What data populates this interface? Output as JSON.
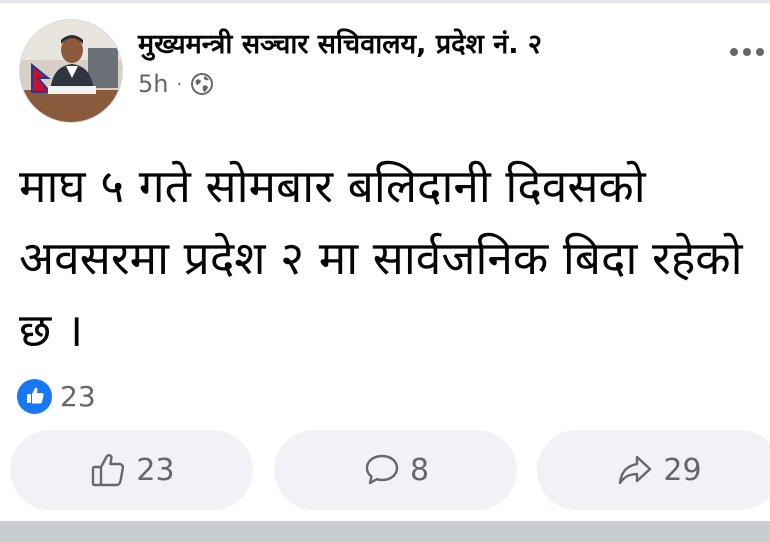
{
  "post": {
    "page_name": "मुख्यमन्त्री सञ्चार सचिवालय, प्रदेश नं. २",
    "time": "5h",
    "separator": "·",
    "privacy_icon": "globe-icon",
    "more_icon": "more-options-icon",
    "text": "माघ ५ गते सोमबार बलिदानी दिवसको अवसरमा प्रदेश २ मा सार्वजनिक बिदा रहेको छ ।"
  },
  "reactions": {
    "icon": "like-reaction-icon",
    "count": "23"
  },
  "actions": {
    "like_count": "23",
    "comment_count": "8",
    "share_count": "29"
  },
  "colors": {
    "accent": "#1877f2",
    "secondary_text": "#65676b",
    "button_bg": "#f0f2f5"
  }
}
